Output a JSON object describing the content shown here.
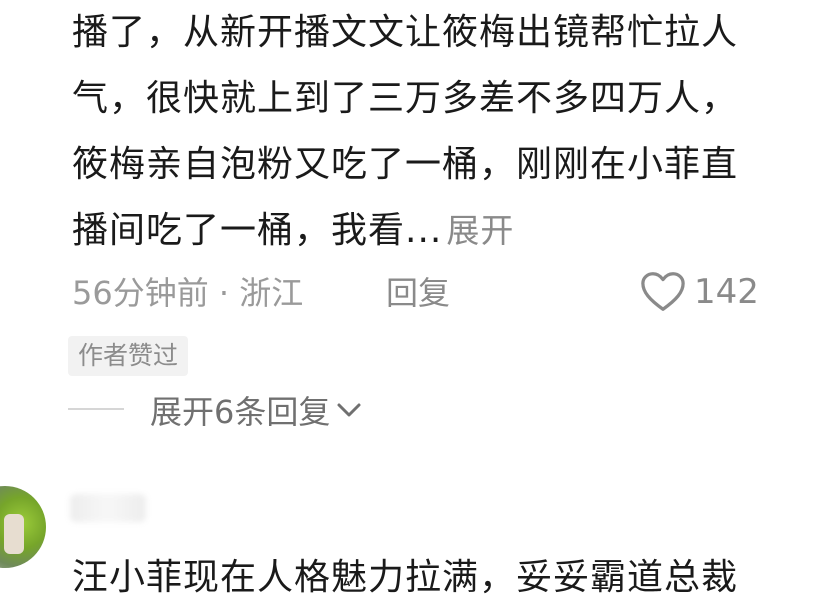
{
  "comment": {
    "lines": [
      "播了，从新开播文文让筱梅出镜帮忙拉人",
      "气，很快就上到了三万多差不多四万人，",
      "筱梅亲自泡粉又吃了一桶，刚刚在小菲直",
      "播间吃了一桶，我看..."
    ],
    "expand_label": "展开",
    "meta": "56分钟前 · 浙江",
    "reply_label": "回复",
    "likes": "142",
    "author_liked_badge": "作者赞过",
    "expand_replies_label": "展开6条回复"
  },
  "next_comment": {
    "text": "汪小菲现在人格魅力拉满，妥妥霸道总裁"
  },
  "icons": {
    "like": "heart-icon",
    "expand": "chevron-down-icon"
  },
  "colors": {
    "text": "#1a1a1a",
    "muted": "#9a9a9a",
    "badge_bg": "#f2f2f2"
  }
}
